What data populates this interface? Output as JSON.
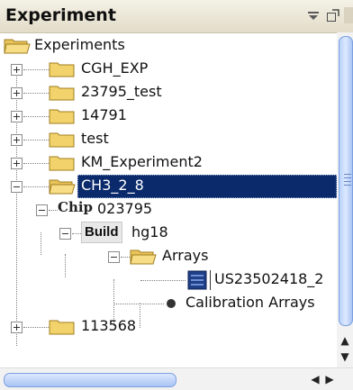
{
  "panel": {
    "title": "Experiment",
    "minimize_icon": "minimize-icon",
    "maximize_icon": "maximize-icon"
  },
  "tree": {
    "root": "Experiments",
    "items": [
      "CGH_EXP",
      "23795_test",
      "14791",
      "test",
      "KM_Experiment2",
      "CH3_2_8"
    ],
    "chip": {
      "tag": "Chip",
      "label": "023795"
    },
    "build": {
      "tag": "Build",
      "label": "hg18"
    },
    "arrays": "Arrays",
    "array_item": "US23502418_2",
    "calibration": "Calibration Arrays",
    "last_item": "113568"
  },
  "colors": {
    "selection": "#0a2a6b",
    "folder": "#f2d36b",
    "scroll_thumb": "#b9d2fb"
  }
}
